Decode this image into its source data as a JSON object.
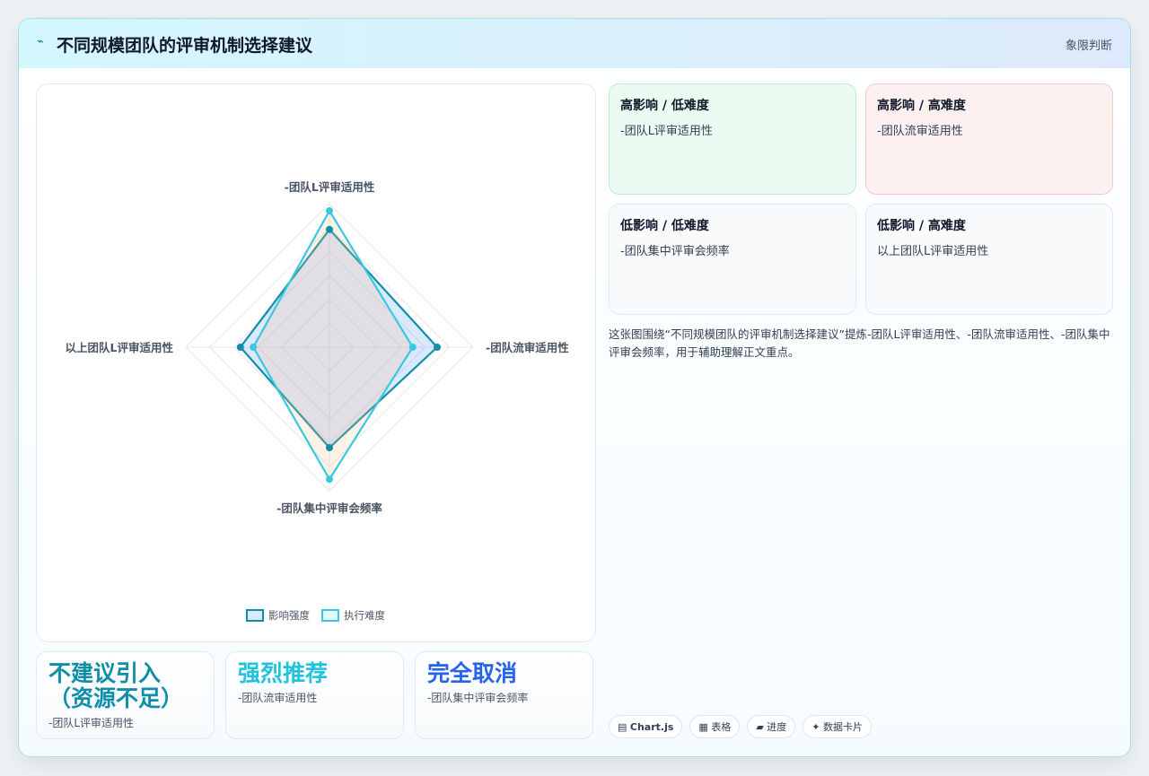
{
  "header": {
    "mark": "⌁",
    "title": "不同规模团队的评审机制选择建议",
    "tag": "象限判断"
  },
  "chart_data": {
    "type": "radar",
    "axes": [
      "-团队L评审适用性",
      "-团队流审适用性",
      "-团队集中评审会频率",
      "以上团队L评审适用性"
    ],
    "rmax": 100,
    "rings": 6,
    "series": [
      {
        "name": "影响强度",
        "values": [
          82,
          75,
          70,
          62
        ],
        "color": "#0e8fa8",
        "fill": "rgba(59,130,246,0.18)"
      },
      {
        "name": "执行难度",
        "values": [
          95,
          58,
          92,
          53
        ],
        "color": "#38c9e0",
        "fill": "rgba(251,191,140,0.22)"
      }
    ]
  },
  "kpis": [
    {
      "value": "不建议引入（资源不足）",
      "label": "-团队L评审适用性",
      "color": "#0e8fa8"
    },
    {
      "value": "强烈推荐",
      "label": "-团队流审适用性",
      "color": "#22c3dd"
    },
    {
      "value": "完全取消",
      "label": "-团队集中评审会频率",
      "color": "#2563eb"
    }
  ],
  "quadrants": [
    {
      "title": "高影响 / 低难度",
      "item": "-团队L评审适用性"
    },
    {
      "title": "高影响 / 高难度",
      "item": "-团队流审适用性"
    },
    {
      "title": "低影响 / 低难度",
      "item": "-团队集中评审会频率"
    },
    {
      "title": "低影响 / 高难度",
      "item": "以上团队L评审适用性"
    }
  ],
  "description": "这张图围绕“不同规模团队的评审机制选择建议”提炼-团队L评审适用性、-团队流审适用性、-团队集中评审会频率，用于辅助理解正文重点。",
  "chips": [
    {
      "icon": "▤",
      "label": "Chart.js"
    },
    {
      "icon": "▦",
      "label": "表格"
    },
    {
      "icon": "▰",
      "label": "进度"
    },
    {
      "icon": "✦",
      "label": "数据卡片"
    }
  ]
}
